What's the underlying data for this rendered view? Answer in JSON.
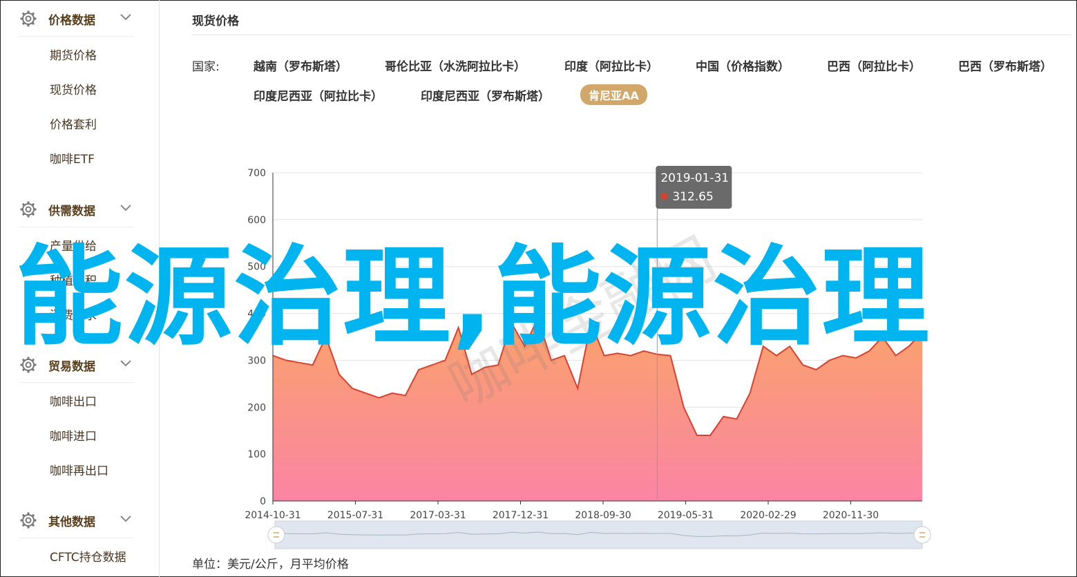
{
  "sidebar": {
    "sections": [
      {
        "title": "价格数据",
        "items": [
          "期货价格",
          "现货价格",
          "价格套利",
          "咖啡ETF"
        ]
      },
      {
        "title": "供需数据",
        "items": [
          "产量供给",
          "种植面积",
          "消费需求"
        ]
      },
      {
        "title": "贸易数据",
        "items": [
          "咖啡出口",
          "咖啡进口",
          "咖啡再出口"
        ]
      },
      {
        "title": "其他数据",
        "items": [
          "CFTC持仓数据"
        ]
      }
    ]
  },
  "main": {
    "title": "现货价格",
    "filter_label": "国家:",
    "chips": [
      "越南（罗布斯塔）",
      "哥伦比亚（水洗阿拉比卡）",
      "印度（阿拉比卡）",
      "中国（价格指数）",
      "巴西（阿拉比卡）",
      "巴西（罗布斯塔）",
      "印度尼西亚（阿拉比卡）",
      "印度尼西亚（罗布斯塔）",
      "肯尼亚AA"
    ],
    "active_chip": "肯尼亚AA",
    "unit_note": "单位：美元/公斤，月平均价格"
  },
  "overlay_text": "能源治理,能源治理",
  "watermark_text": "咖啡金融网",
  "colors": {
    "accent": "#d1a86a",
    "line": "#d9412e",
    "fill_top": "#f9a36a",
    "fill_bottom": "#fb84a4",
    "overlay": "#00b4f0"
  },
  "chart_data": {
    "type": "area",
    "x_ticks": [
      "2014-10-31",
      "2015-07-31",
      "2017-03-31",
      "2017-12-31",
      "2018-09-30",
      "2019-05-31",
      "2020-02-29",
      "2020-11-30"
    ],
    "y_ticks": [
      0,
      100,
      200,
      300,
      400,
      500,
      600,
      700
    ],
    "ylim": [
      0,
      700
    ],
    "values": [
      310,
      300,
      295,
      290,
      350,
      270,
      240,
      230,
      220,
      230,
      225,
      280,
      290,
      300,
      370,
      270,
      285,
      290,
      380,
      330,
      390,
      300,
      310,
      240,
      380,
      310,
      315,
      310,
      320,
      312.65,
      310,
      200,
      140,
      140,
      180,
      175,
      230,
      330,
      310,
      330,
      290,
      280,
      300,
      310,
      305,
      320,
      350,
      310,
      330,
      360
    ],
    "tooltip": {
      "date": "2019-01-31",
      "value": "312.65",
      "index": 29
    },
    "grid": true,
    "legend": "none"
  }
}
